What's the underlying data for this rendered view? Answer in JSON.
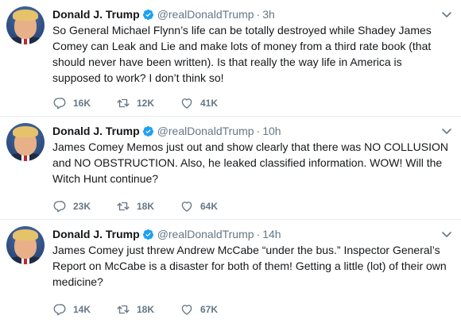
{
  "tweets": [
    {
      "name": "Donald J. Trump",
      "handle": "@realDonaldTrump",
      "separator": "·",
      "time": "3h",
      "text": "So General Michael Flynn’s life can be totally destroyed while Shadey James Comey can Leak and Lie and make lots of money from a third rate book (that should never have been written). Is that really the way life in America is supposed to work? I don’t think so!",
      "replies": "16K",
      "retweets": "12K",
      "likes": "41K"
    },
    {
      "name": "Donald J. Trump",
      "handle": "@realDonaldTrump",
      "separator": "·",
      "time": "10h",
      "text": "James Comey Memos just out and show clearly that there was NO COLLUSION and NO OBSTRUCTION. Also, he leaked classified information. WOW! Will the Witch Hunt continue?",
      "replies": "23K",
      "retweets": "18K",
      "likes": "64K"
    },
    {
      "name": "Donald J. Trump",
      "handle": "@realDonaldTrump",
      "separator": "·",
      "time": "14h",
      "text": "James Comey just threw Andrew McCabe “under the bus.” Inspector General’s Report on McCabe is a disaster for both of them! Getting a little (lot) of their own medicine?",
      "replies": "14K",
      "retweets": "18K",
      "likes": "67K"
    }
  ],
  "colors": {
    "text": "#14171a",
    "secondary": "#657786",
    "verified": "#1da1f2",
    "divider": "#e6ecf0"
  },
  "icons": {
    "verified": "verified-badge-icon",
    "caret": "chevron-down-icon",
    "reply": "reply-icon",
    "retweet": "retweet-icon",
    "like": "heart-icon",
    "avatar": "profile-photo"
  }
}
